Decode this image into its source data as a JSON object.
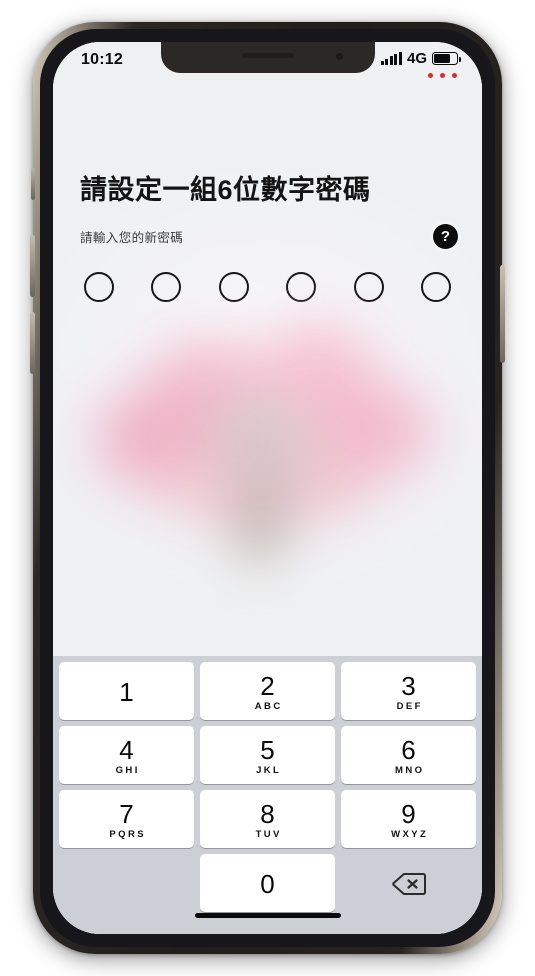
{
  "device": {
    "type": "smartphone-mockup",
    "frame_color": "#201e1c",
    "side_buttons": [
      "mute-switch",
      "volume-up",
      "volume-down",
      "power"
    ]
  },
  "status_bar": {
    "time": "10:12",
    "network_label": "4G",
    "signal_bars": 5,
    "battery_level_percent": 72,
    "recording_dots": 3,
    "recording_dot_color": "#e02a2a"
  },
  "screen": {
    "title": "請設定一組6位數字密碼",
    "subtitle": "請輸入您的新密碼",
    "help_icon": "question-mark-icon",
    "help_label": "?",
    "pin": {
      "length": 6,
      "filled": 0,
      "dot_border_color": "#17171a"
    },
    "illustration": {
      "name": "blurred-illustration",
      "description": "blurred pink and grey graphic",
      "primary_color": "#f2b8cb",
      "secondary_color": "#c3b4ae"
    }
  },
  "keypad": {
    "background_color": "#ccd0d6",
    "key_color": "#ffffff",
    "rows": [
      [
        {
          "digit": "1",
          "letters": ""
        },
        {
          "digit": "2",
          "letters": "ABC"
        },
        {
          "digit": "3",
          "letters": "DEF"
        }
      ],
      [
        {
          "digit": "4",
          "letters": "GHI"
        },
        {
          "digit": "5",
          "letters": "JKL"
        },
        {
          "digit": "6",
          "letters": "MNO"
        }
      ],
      [
        {
          "digit": "7",
          "letters": "PQRS"
        },
        {
          "digit": "8",
          "letters": "TUV"
        },
        {
          "digit": "9",
          "letters": "WXYZ"
        }
      ],
      [
        {
          "digit": "",
          "letters": "",
          "kind": "blank"
        },
        {
          "digit": "0",
          "letters": ""
        },
        {
          "digit": "",
          "letters": "",
          "kind": "delete",
          "icon": "backspace-icon"
        }
      ]
    ]
  },
  "home_indicator": {
    "color": "#0a0a0a"
  }
}
